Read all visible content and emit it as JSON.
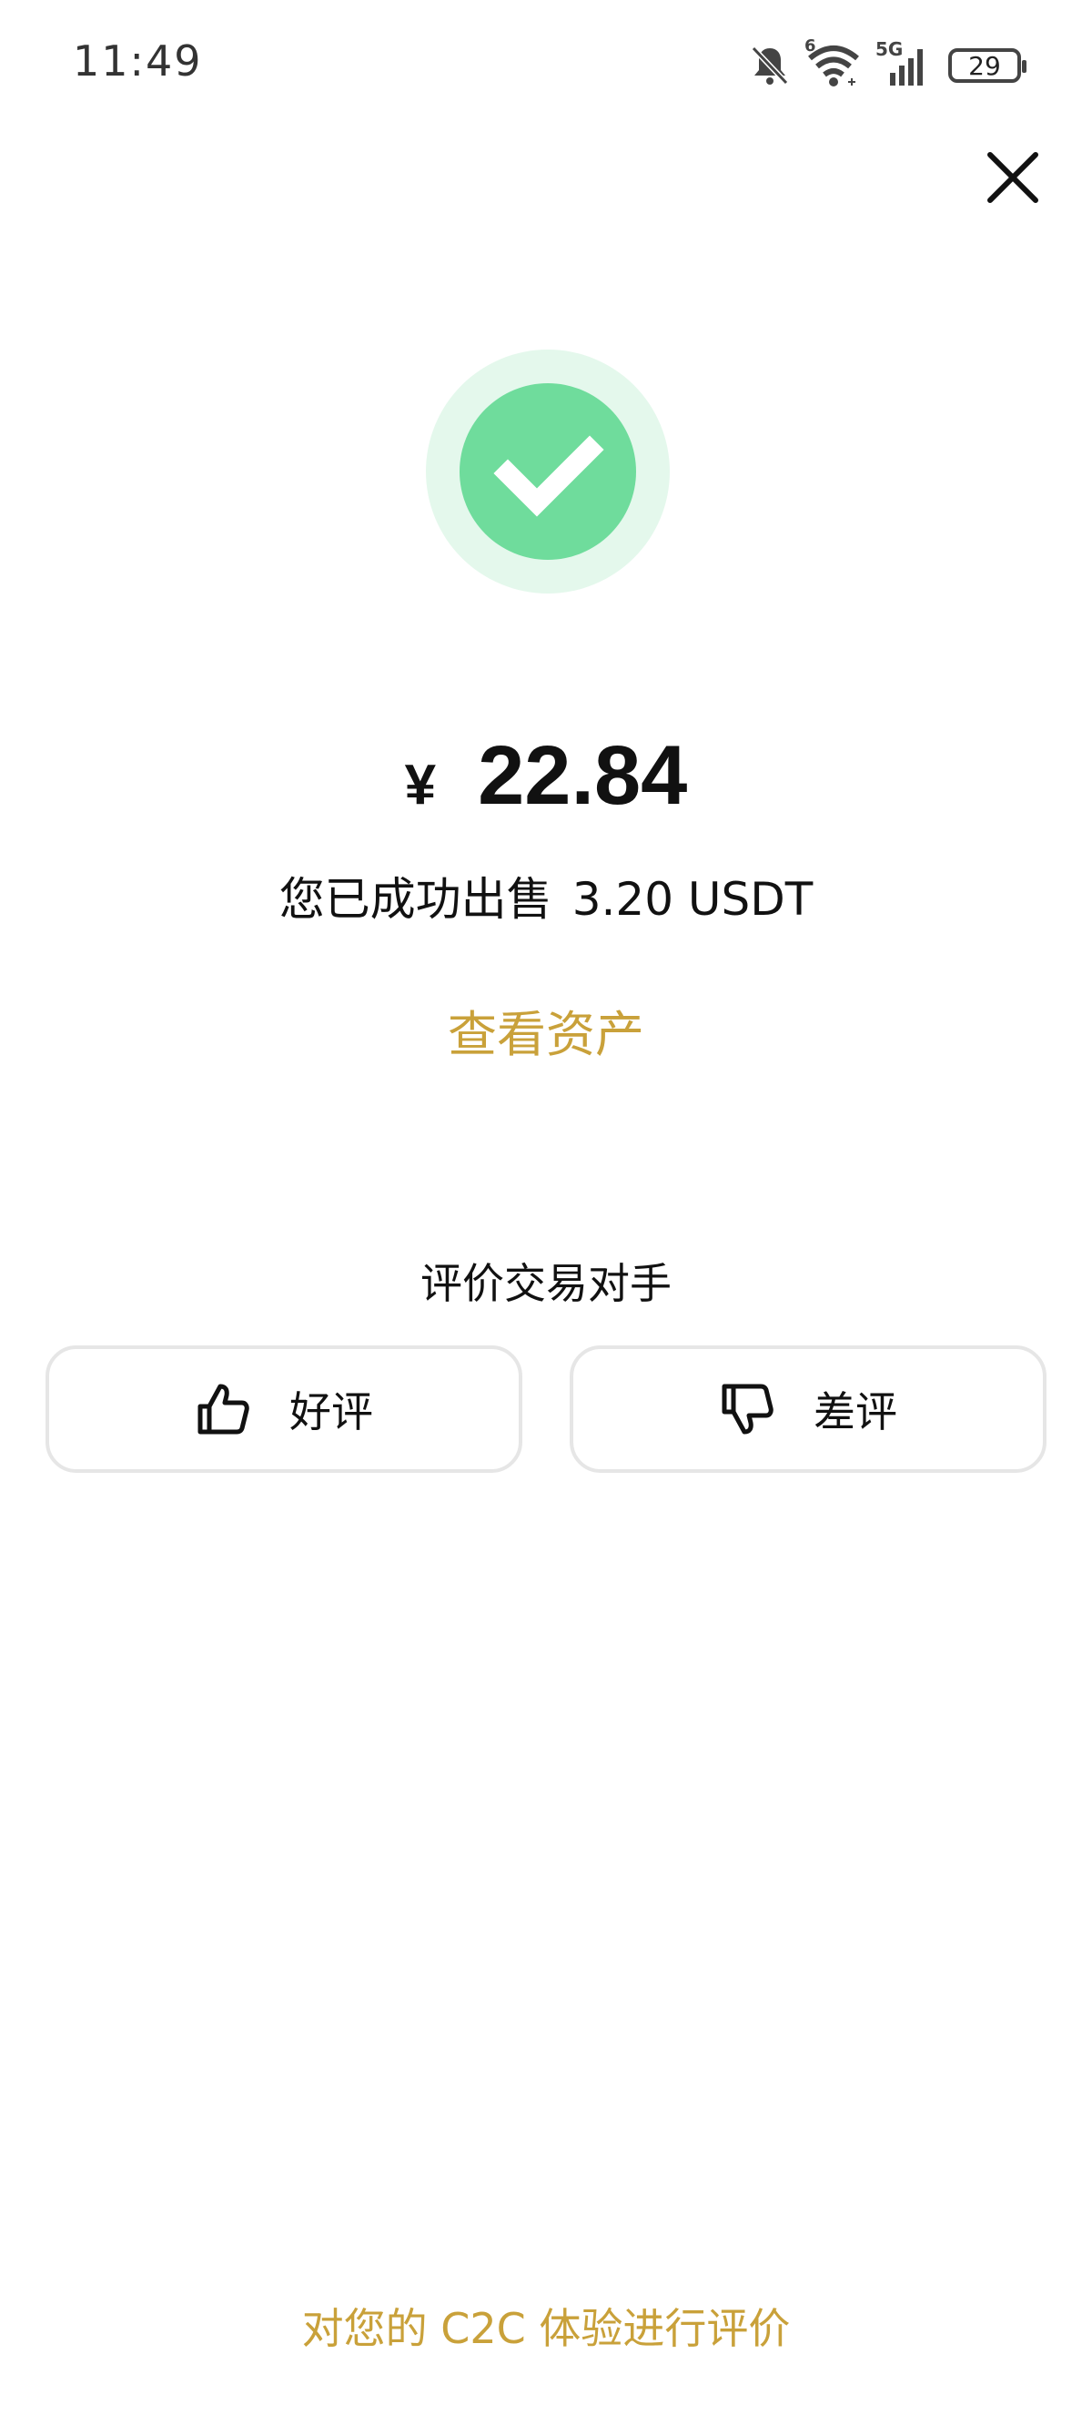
{
  "status_bar": {
    "time": "11:49",
    "battery": "29",
    "network": "5G",
    "wifi_badge": "6",
    "icons": [
      "bell-off-icon",
      "wifi-icon",
      "signal-icon",
      "battery-icon"
    ]
  },
  "header": {
    "close_icon": "close-icon"
  },
  "result": {
    "status_icon": "check-circle-icon",
    "currency_symbol": "¥",
    "amount": "22.84",
    "sold_prefix": "您已成功出售",
    "sold_amount": "3.20 USDT",
    "view_assets_label": "查看资产"
  },
  "rating": {
    "title": "评价交易对手",
    "good_label": "好评",
    "good_icon": "thumbs-up-icon",
    "bad_label": "差评",
    "bad_icon": "thumbs-down-icon"
  },
  "footer": {
    "rate_experience_label": "对您的 C2C 体验进行评价"
  },
  "colors": {
    "accent": "#c9a13a",
    "success": "#6fdc9c",
    "success_halo": "#e4f8ec",
    "border": "#e6e6e6"
  }
}
